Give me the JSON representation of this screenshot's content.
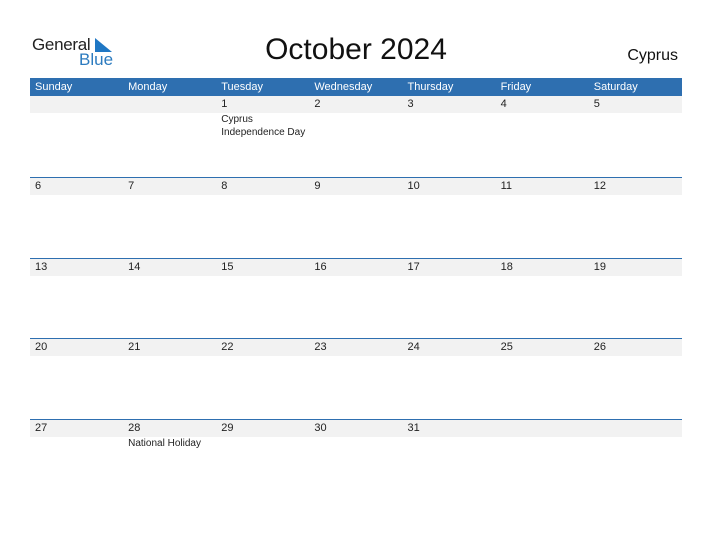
{
  "logo": {
    "word1": "General",
    "word2": "Blue"
  },
  "title": "October 2024",
  "country": "Cyprus",
  "colors": {
    "accent": "#2e6fb0",
    "logo_blue": "#2c7bbf",
    "day_bar": "#f2f2f2"
  },
  "weekdays": [
    "Sunday",
    "Monday",
    "Tuesday",
    "Wednesday",
    "Thursday",
    "Friday",
    "Saturday"
  ],
  "weeks": [
    {
      "days": [
        "",
        "",
        "1",
        "2",
        "3",
        "4",
        "5"
      ],
      "events": [
        "",
        "",
        "Cyprus Independence Day",
        "",
        "",
        "",
        ""
      ]
    },
    {
      "days": [
        "6",
        "7",
        "8",
        "9",
        "10",
        "11",
        "12"
      ],
      "events": [
        "",
        "",
        "",
        "",
        "",
        "",
        ""
      ]
    },
    {
      "days": [
        "13",
        "14",
        "15",
        "16",
        "17",
        "18",
        "19"
      ],
      "events": [
        "",
        "",
        "",
        "",
        "",
        "",
        ""
      ]
    },
    {
      "days": [
        "20",
        "21",
        "22",
        "23",
        "24",
        "25",
        "26"
      ],
      "events": [
        "",
        "",
        "",
        "",
        "",
        "",
        ""
      ]
    },
    {
      "days": [
        "27",
        "28",
        "29",
        "30",
        "31",
        "",
        ""
      ],
      "events": [
        "",
        "National Holiday",
        "",
        "",
        "",
        "",
        ""
      ]
    }
  ]
}
